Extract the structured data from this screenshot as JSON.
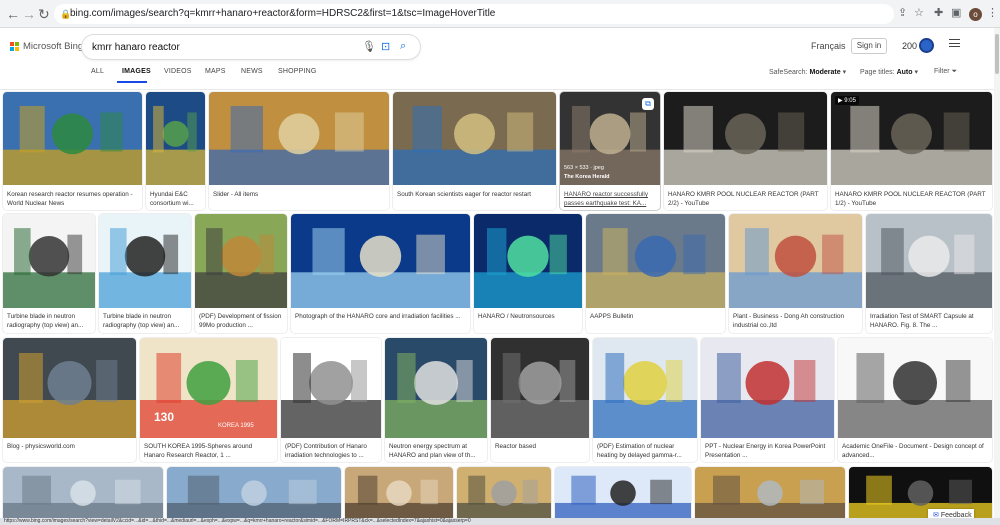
{
  "browser": {
    "url": "bing.com/images/search?q=kmrr+hanaro+reactor&form=HDRSC2&first=1&tsc=ImageHoverTitle",
    "profile_initial": "o",
    "status_text": "https://www.bing.com/images/search?view=detailV2&ccid=...&id=...&thid=...&mediaurl=...&exph=...&expw=...&q=kmrr+hanaro+reactor&simid=...&FORM=IRPRST&ck=...&selectedIndex=7&ajaxhist=0&ajaxserp=0"
  },
  "header": {
    "brand": "Microsoft Bing",
    "query": "kmrr hanaro reactor",
    "language": "Français",
    "signin": "Sign in",
    "rewards": "200",
    "brand_colors": [
      "#f25022",
      "#7fba00",
      "#00a4ef",
      "#ffb900"
    ]
  },
  "tabs": [
    "ALL",
    "IMAGES",
    "VIDEOS",
    "MAPS",
    "NEWS",
    "SHOPPING"
  ],
  "filters": {
    "safesearch_label": "SafeSearch:",
    "safesearch_value": "Moderate",
    "pagetitles_label": "Page titles:",
    "pagetitles_value": "Auto",
    "filter_label": "Filter"
  },
  "results": [
    {
      "caption": "Korean research reactor resumes operation - World Nuclear News",
      "colors": [
        "#3a6fb0",
        "#c8a020",
        "#2e8a3e"
      ]
    },
    {
      "caption": "Hyundai E&C consortium wi...",
      "colors": [
        "#1d4b86",
        "#d6b43a",
        "#56a04a"
      ]
    },
    {
      "caption": "Slider - All items",
      "colors": [
        "#c09040",
        "#3c6ab0",
        "#e0d0a0"
      ]
    },
    {
      "caption": "South Korean scientists eager for reactor restart",
      "colors": [
        "#7a6a50",
        "#2f6fb5",
        "#d4c080"
      ]
    },
    {
      "caption": "HANARO reactor successfully passes earthquake test: KA...",
      "overlay1": "563 × 533 · jpeg",
      "overlay2": "The Korea Herald",
      "colors": [
        "#333333",
        "#8a7a6a",
        "#c0b090"
      ]
    },
    {
      "caption": "HANARO KMRR POOL NUCLEAR REACTOR (PART 2/2) - YouTube",
      "colors": [
        "#1c1c1c",
        "#d8d4c8",
        "#6a6458"
      ]
    },
    {
      "caption": "HANARO KMRR POOL NUCLEAR REACTOR (PART 1/2) - YouTube",
      "badge": "▶ 9:05",
      "colors": [
        "#1c1c1c",
        "#d8d4c8",
        "#6a6458"
      ]
    },
    {
      "caption": "Turbine blade in neutron radiography (top view) an...",
      "colors": [
        "#f4f4f4",
        "#2e6e3a",
        "#333333"
      ]
    },
    {
      "caption": "Turbine blade in neutron radiography (top view) an...",
      "colors": [
        "#e8f4f8",
        "#4aa0d8",
        "#222222"
      ]
    },
    {
      "caption": "(PDF) Development of fission 99Mo production ...",
      "colors": [
        "#88a858",
        "#404040",
        "#c08838"
      ]
    },
    {
      "caption": "Photograph of the HANARO core and irradiation facilities ...",
      "colors": [
        "#0c3a8a",
        "#9ad0f0",
        "#e8e0c8"
      ]
    },
    {
      "caption": "HANARO / Neutronsources",
      "colors": [
        "#0a2a6a",
        "#1ea0d0",
        "#50e0a0"
      ]
    },
    {
      "caption": "AAPPS Bulletin",
      "colors": [
        "#6a7a8a",
        "#c8b060",
        "#3a6ab0"
      ]
    },
    {
      "caption": "Plant - Business - Dong Ah construction industrial co.,ltd",
      "colors": [
        "#e0c8a0",
        "#6a9ad0",
        "#c05040"
      ]
    },
    {
      "caption": "Irradiation Test of SMART Capsule at HANARO. Fig. 8. The ...",
      "colors": [
        "#b8c0c8",
        "#505860",
        "#eaeaea"
      ]
    },
    {
      "caption": "Blog - physicsworld.com",
      "colors": [
        "#404850",
        "#d0a030",
        "#708090"
      ]
    },
    {
      "caption": "SOUTH KOREA 1995-Spheres around Hanaro Research Reactor, 1 ...",
      "stamp": "130",
      "stamp_year": "KOREA 1995",
      "colors": [
        "#f0e4c8",
        "#e04030",
        "#40a040"
      ]
    },
    {
      "caption": "(PDF) Contribution of Hanaro irradiation technologies to ...",
      "colors": [
        "#ffffff",
        "#303030",
        "#909090"
      ]
    },
    {
      "caption": "Neutron energy spectrum at HANARO and plan view of th...",
      "colors": [
        "#2a4a6a",
        "#80b060",
        "#e0e0e0"
      ]
    },
    {
      "caption": "Reactor based",
      "colors": [
        "#303030",
        "#707070",
        "#a0a0a0"
      ]
    },
    {
      "caption": "(PDF) Estimation of nuclear heating by delayed gamma-r...",
      "colors": [
        "#dfe8f0",
        "#3070c0",
        "#e0d040"
      ]
    },
    {
      "caption": "PPT - Nuclear Energy in Korea PowerPoint Presentation ...",
      "colors": [
        "#e8e8f0",
        "#4060a0",
        "#c03030"
      ]
    },
    {
      "caption": "Academic OneFile - Document - Design concept of advanced...",
      "colors": [
        "#f8f8f8",
        "#606060",
        "#303030"
      ]
    },
    {
      "caption": "",
      "colors": [
        "#a8b8c8",
        "#6a7a88",
        "#d8e0e8"
      ]
    },
    {
      "caption": "",
      "colors": [
        "#88aacc",
        "#506070",
        "#c0d0e0"
      ]
    },
    {
      "caption": "",
      "colors": [
        "#c8a878",
        "#504030",
        "#e8d8c0"
      ]
    },
    {
      "caption": "",
      "colors": [
        "#d0b070",
        "#505040",
        "#a0a0a0"
      ]
    },
    {
      "caption": "",
      "colors": [
        "#dde8f8",
        "#3060c0",
        "#222222"
      ]
    },
    {
      "caption": "",
      "colors": [
        "#c8a050",
        "#605040",
        "#b0b8c0"
      ]
    },
    {
      "caption": "",
      "colors": [
        "#101010",
        "#f0d020",
        "#606060"
      ]
    }
  ],
  "feedback": "Feedback"
}
